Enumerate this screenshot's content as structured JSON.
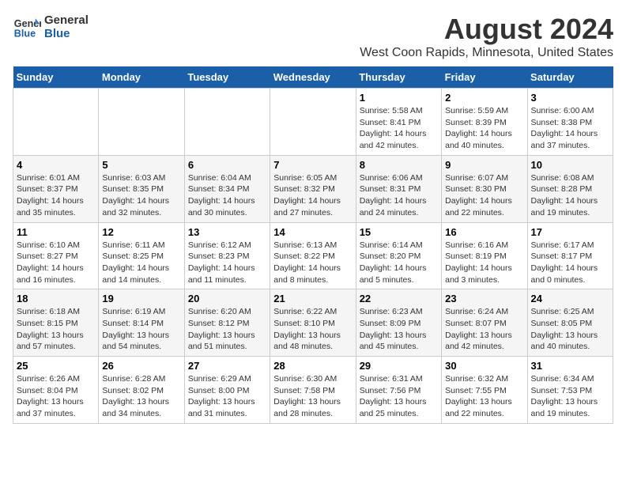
{
  "logo": {
    "line1": "General",
    "line2": "Blue"
  },
  "title": "August 2024",
  "subtitle": "West Coon Rapids, Minnesota, United States",
  "days_of_week": [
    "Sunday",
    "Monday",
    "Tuesday",
    "Wednesday",
    "Thursday",
    "Friday",
    "Saturday"
  ],
  "weeks": [
    [
      {
        "day": "",
        "info": ""
      },
      {
        "day": "",
        "info": ""
      },
      {
        "day": "",
        "info": ""
      },
      {
        "day": "",
        "info": ""
      },
      {
        "day": "1",
        "info": "Sunrise: 5:58 AM\nSunset: 8:41 PM\nDaylight: 14 hours and 42 minutes."
      },
      {
        "day": "2",
        "info": "Sunrise: 5:59 AM\nSunset: 8:39 PM\nDaylight: 14 hours and 40 minutes."
      },
      {
        "day": "3",
        "info": "Sunrise: 6:00 AM\nSunset: 8:38 PM\nDaylight: 14 hours and 37 minutes."
      }
    ],
    [
      {
        "day": "4",
        "info": "Sunrise: 6:01 AM\nSunset: 8:37 PM\nDaylight: 14 hours and 35 minutes."
      },
      {
        "day": "5",
        "info": "Sunrise: 6:03 AM\nSunset: 8:35 PM\nDaylight: 14 hours and 32 minutes."
      },
      {
        "day": "6",
        "info": "Sunrise: 6:04 AM\nSunset: 8:34 PM\nDaylight: 14 hours and 30 minutes."
      },
      {
        "day": "7",
        "info": "Sunrise: 6:05 AM\nSunset: 8:32 PM\nDaylight: 14 hours and 27 minutes."
      },
      {
        "day": "8",
        "info": "Sunrise: 6:06 AM\nSunset: 8:31 PM\nDaylight: 14 hours and 24 minutes."
      },
      {
        "day": "9",
        "info": "Sunrise: 6:07 AM\nSunset: 8:30 PM\nDaylight: 14 hours and 22 minutes."
      },
      {
        "day": "10",
        "info": "Sunrise: 6:08 AM\nSunset: 8:28 PM\nDaylight: 14 hours and 19 minutes."
      }
    ],
    [
      {
        "day": "11",
        "info": "Sunrise: 6:10 AM\nSunset: 8:27 PM\nDaylight: 14 hours and 16 minutes."
      },
      {
        "day": "12",
        "info": "Sunrise: 6:11 AM\nSunset: 8:25 PM\nDaylight: 14 hours and 14 minutes."
      },
      {
        "day": "13",
        "info": "Sunrise: 6:12 AM\nSunset: 8:23 PM\nDaylight: 14 hours and 11 minutes."
      },
      {
        "day": "14",
        "info": "Sunrise: 6:13 AM\nSunset: 8:22 PM\nDaylight: 14 hours and 8 minutes."
      },
      {
        "day": "15",
        "info": "Sunrise: 6:14 AM\nSunset: 8:20 PM\nDaylight: 14 hours and 5 minutes."
      },
      {
        "day": "16",
        "info": "Sunrise: 6:16 AM\nSunset: 8:19 PM\nDaylight: 14 hours and 3 minutes."
      },
      {
        "day": "17",
        "info": "Sunrise: 6:17 AM\nSunset: 8:17 PM\nDaylight: 14 hours and 0 minutes."
      }
    ],
    [
      {
        "day": "18",
        "info": "Sunrise: 6:18 AM\nSunset: 8:15 PM\nDaylight: 13 hours and 57 minutes."
      },
      {
        "day": "19",
        "info": "Sunrise: 6:19 AM\nSunset: 8:14 PM\nDaylight: 13 hours and 54 minutes."
      },
      {
        "day": "20",
        "info": "Sunrise: 6:20 AM\nSunset: 8:12 PM\nDaylight: 13 hours and 51 minutes."
      },
      {
        "day": "21",
        "info": "Sunrise: 6:22 AM\nSunset: 8:10 PM\nDaylight: 13 hours and 48 minutes."
      },
      {
        "day": "22",
        "info": "Sunrise: 6:23 AM\nSunset: 8:09 PM\nDaylight: 13 hours and 45 minutes."
      },
      {
        "day": "23",
        "info": "Sunrise: 6:24 AM\nSunset: 8:07 PM\nDaylight: 13 hours and 42 minutes."
      },
      {
        "day": "24",
        "info": "Sunrise: 6:25 AM\nSunset: 8:05 PM\nDaylight: 13 hours and 40 minutes."
      }
    ],
    [
      {
        "day": "25",
        "info": "Sunrise: 6:26 AM\nSunset: 8:04 PM\nDaylight: 13 hours and 37 minutes."
      },
      {
        "day": "26",
        "info": "Sunrise: 6:28 AM\nSunset: 8:02 PM\nDaylight: 13 hours and 34 minutes."
      },
      {
        "day": "27",
        "info": "Sunrise: 6:29 AM\nSunset: 8:00 PM\nDaylight: 13 hours and 31 minutes."
      },
      {
        "day": "28",
        "info": "Sunrise: 6:30 AM\nSunset: 7:58 PM\nDaylight: 13 hours and 28 minutes."
      },
      {
        "day": "29",
        "info": "Sunrise: 6:31 AM\nSunset: 7:56 PM\nDaylight: 13 hours and 25 minutes."
      },
      {
        "day": "30",
        "info": "Sunrise: 6:32 AM\nSunset: 7:55 PM\nDaylight: 13 hours and 22 minutes."
      },
      {
        "day": "31",
        "info": "Sunrise: 6:34 AM\nSunset: 7:53 PM\nDaylight: 13 hours and 19 minutes."
      }
    ]
  ]
}
